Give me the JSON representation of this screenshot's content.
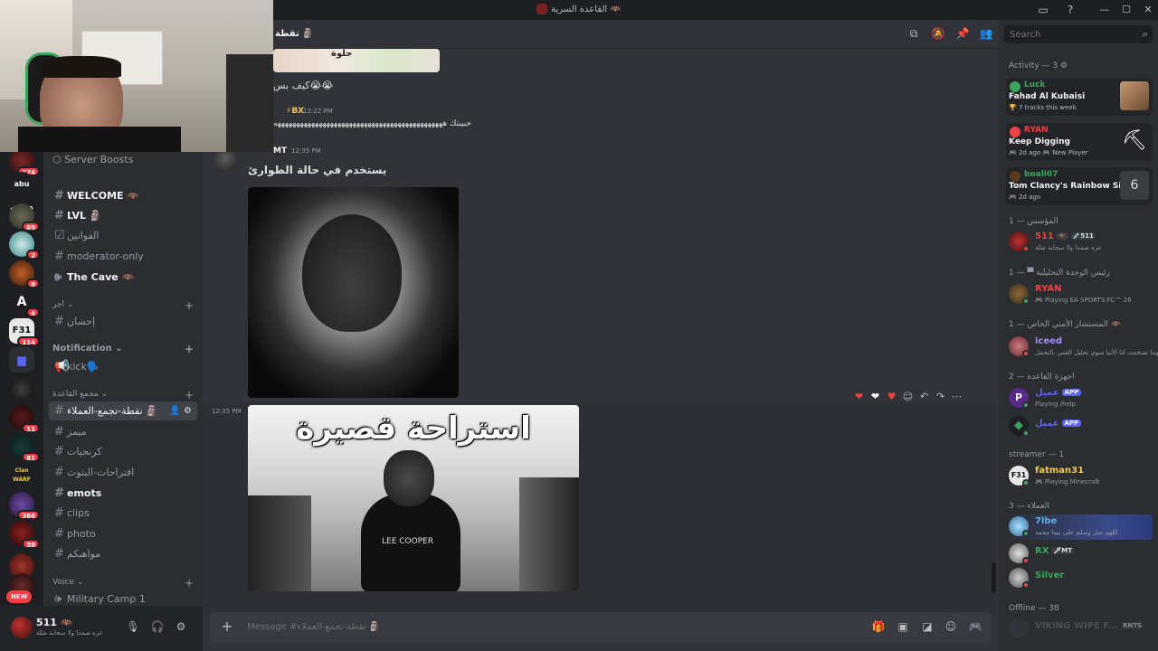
{
  "window": {
    "title": "القاعدة السرية 🦇"
  },
  "servers": [
    {
      "badge": "174"
    },
    {
      "label": "abu d7m0",
      "badge": ""
    },
    {
      "badge": "69"
    },
    {
      "badge": "2"
    },
    {
      "badge": "9"
    },
    {
      "label": "A",
      "badge": "4"
    },
    {
      "label": "F31",
      "badge": "114"
    },
    {
      "badge": ""
    },
    {
      "badge": ""
    },
    {
      "badge": "11"
    },
    {
      "badge": "81"
    },
    {
      "label": "Clan WARF",
      "badge": ""
    },
    {
      "badge": "366"
    },
    {
      "badge": "38"
    },
    {
      "badge": ""
    },
    {
      "badge": ""
    }
  ],
  "new_label": "NEW",
  "sidebar": {
    "boosts": "Server Boosts",
    "channels": [
      {
        "name": "WELCOME 🦇",
        "bright": true
      },
      {
        "name": "LVL 🗿",
        "bright": true
      },
      {
        "name": "القوانين",
        "bright": false
      },
      {
        "name": "moderator-only",
        "bright": false
      },
      {
        "name": "The Cave 🦇",
        "bright": true
      }
    ],
    "cat1": "اجر",
    "cat1_channel": "إحسان",
    "cat2": "Notification",
    "cat2_channel": "kick🗣️",
    "cat3": "مجمع القاعدة",
    "cat3_channels": [
      {
        "name": "نقطة-تجمع-العملاء 🗿",
        "active": true
      },
      {
        "name": "ميمز",
        "bright": false
      },
      {
        "name": "كرنجيات",
        "bright": false
      },
      {
        "name": "اقتراحات-البثوث",
        "bright": false
      },
      {
        "name": "emots",
        "bright": true
      },
      {
        "name": "clips",
        "bright": false
      },
      {
        "name": "photo",
        "bright": false
      },
      {
        "name": "مواهبكم",
        "bright": false
      }
    ],
    "cat4": "Voice",
    "voice_channel": "Military Camp 1"
  },
  "user": {
    "name": "511 🦇",
    "status": "عزه صمدا ولا سحابة مثلة"
  },
  "chat": {
    "channel_name": "نقطة 🗿",
    "msg1_text": "كيف بس😭😭",
    "msg2_author": "⚡BX",
    "msg2_time": "12:22 PM",
    "msg2_text": "حبيبتك هههههههههههههههههههههههههههههههههههههههههههههه",
    "msg3_author": "MT",
    "msg3_time": "12:35 PM",
    "msg3_text": "يستخدم في حالة الطوارئ",
    "msg4_time": "12:35 PM",
    "img2_caption": "استراحة قصيرة",
    "img1_partial_text": "حلوة",
    "shirt_text": "LEE COOPER",
    "composer_placeholder": "Message #نقطة-تجمع-العملاء 🗿"
  },
  "members": {
    "search_placeholder": "Search",
    "activity_header": "Activity — 3 ⚙",
    "activities": [
      {
        "user": "Luck",
        "title": "Fahad Al Kubaisi",
        "sub": "🏆 7 tracks this week"
      },
      {
        "user": "RYAN",
        "title": "Keep Digging",
        "sub": "🎮 2d ago  🎮 New Player"
      },
      {
        "user": "boali07",
        "title": "Tom Clancy's Rainbow Six ...",
        "sub": "🎮 2d ago"
      }
    ],
    "groups": [
      {
        "header": "1 — المؤسس"
      },
      {
        "header": "1 — ▀ رئيس الوحدة التحليلية"
      },
      {
        "header": "1 — المستشار الأمني الخاص 🦇"
      },
      {
        "header": "2 — اجهزة القاعدة"
      },
      {
        "header": "streamer — 1"
      },
      {
        "header": "3 — العملاء"
      },
      {
        "header": "Offline — 38"
      }
    ],
    "list": [
      {
        "name": "511",
        "tag": "🦇",
        "tag2": "💉511",
        "sub": "عزه صمدا ولا سحابة مثلة",
        "color": "#f23f43"
      },
      {
        "name": "RYAN",
        "sub": "🎮 Playing EA SPORTS FC™ 26",
        "color": "#f23f43"
      },
      {
        "name": "iceed",
        "sub": "وما تضخمت لنا الأثيا سوى تحليل القس بالتحمل",
        "color": "#a78bfa"
      },
      {
        "name": "عميل",
        "app": "APP",
        "sub": "Playing /help",
        "color": "#5865f2"
      },
      {
        "name": "عميل",
        "app": "APP",
        "sub": "",
        "color": "#5865f2"
      },
      {
        "name": "fatman31",
        "sub": "🎮 Playing Minecraft",
        "color": "#f0c94d"
      },
      {
        "name": "7lbe",
        "sub": "اللهم صل وسلم على نبينا محمد",
        "color": "#5eb4ea"
      },
      {
        "name": "RX",
        "tag": "🗡MT",
        "sub": "",
        "color": "#3ba55d"
      },
      {
        "name": "Silver",
        "sub": "",
        "color": "#3ba55d"
      },
      {
        "name": "VIKING WIPE F...",
        "tag": "RNTS",
        "sub": "",
        "color": "#6d6f78"
      }
    ]
  }
}
